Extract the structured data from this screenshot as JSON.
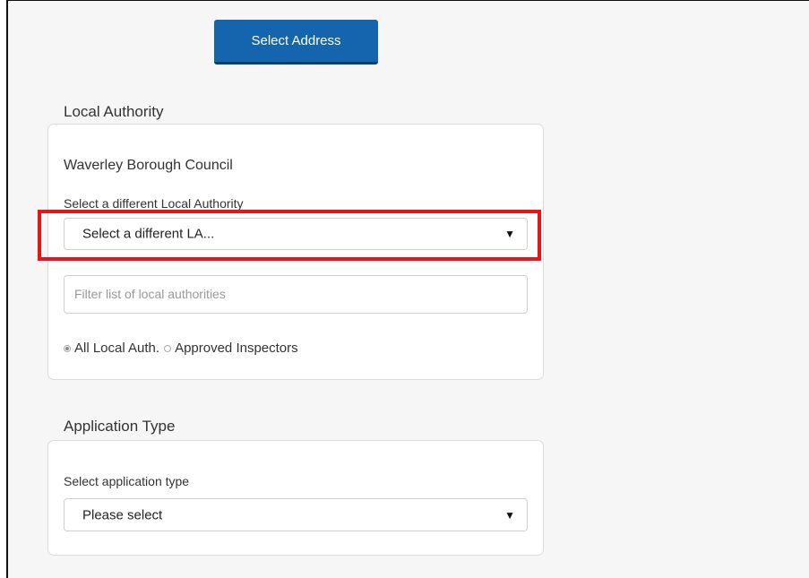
{
  "select_address_button": "Select Address",
  "local_authority": {
    "title": "Local Authority",
    "current": "Waverley Borough Council",
    "different_label": "Select a different Local Authority",
    "select_value": "Select a different LA...",
    "filter_placeholder": "Filter list of local authorities",
    "radios": [
      {
        "label": "All Local Auth.",
        "checked": true
      },
      {
        "label": "Approved Inspectors",
        "checked": false
      }
    ]
  },
  "application_type": {
    "title": "Application Type",
    "label": "Select application type",
    "select_value": "Please select"
  },
  "colors": {
    "primary_button": "#1465ad",
    "highlight": "#e8141a"
  },
  "icons": {
    "caret": "▼"
  }
}
